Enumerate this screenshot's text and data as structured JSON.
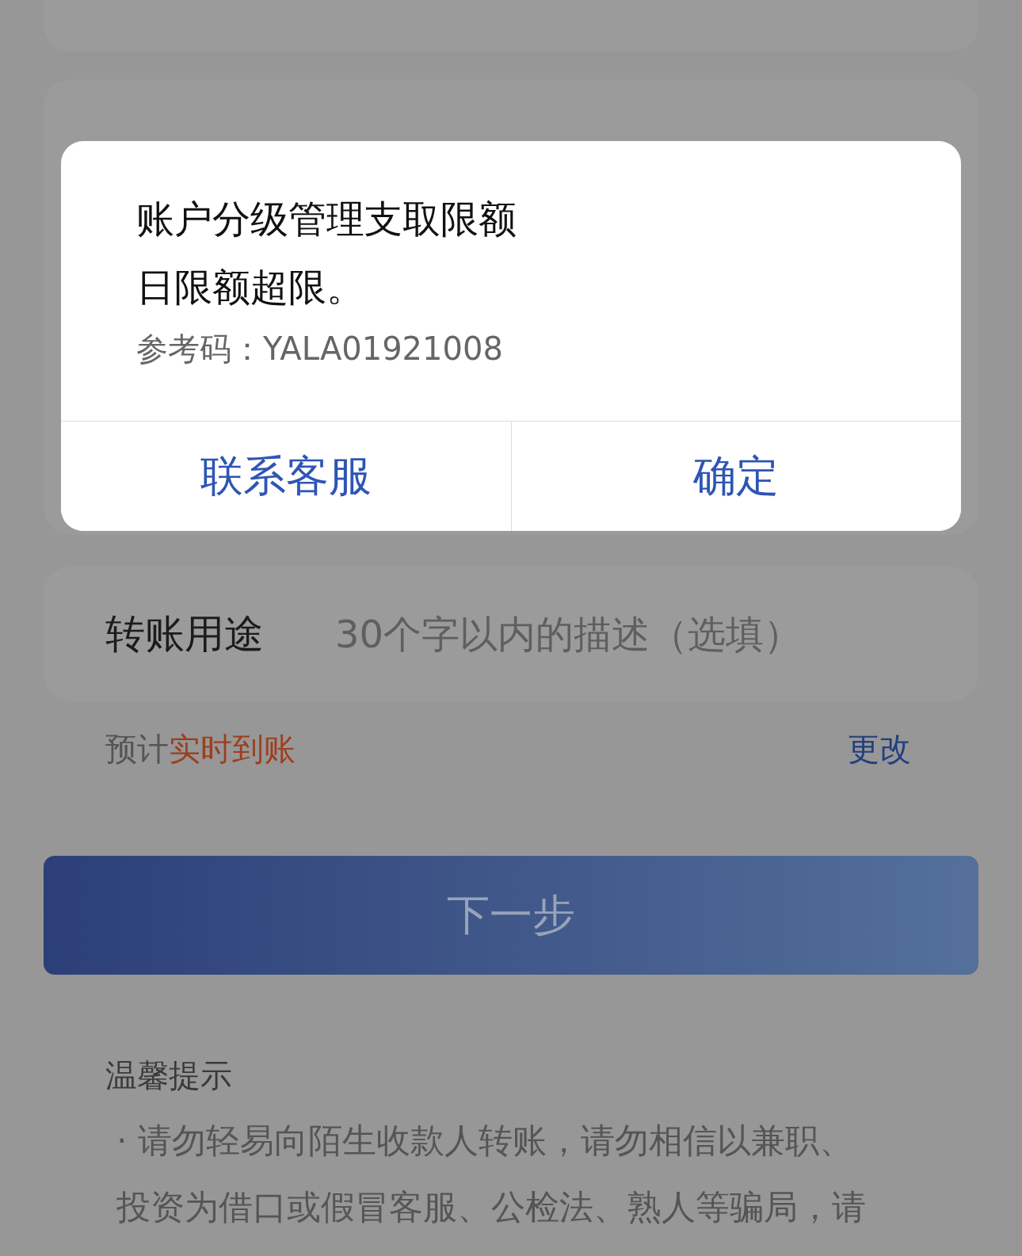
{
  "dialog": {
    "message_lines": [
      "账户分级管理支取限额",
      "日限额超限。"
    ],
    "reference": "参考码：YALA01921008",
    "buttons": [
      {
        "label": "联系客服"
      },
      {
        "label": "确定"
      }
    ]
  },
  "purpose": {
    "label": "转账用途",
    "placeholder": "30个字以内的描述（选填）"
  },
  "arrival": {
    "prefix": "预计",
    "highlight": "实时到账",
    "change": "更改"
  },
  "next_button": "下一步",
  "tips": {
    "title": "温馨提示",
    "items": [
      {
        "bullet": "·",
        "text": "请勿轻易向陌生收款人转账，请勿相信以兼职、投资为借口或假冒客服、公检法、熟人等骗局，请"
      }
    ]
  }
}
